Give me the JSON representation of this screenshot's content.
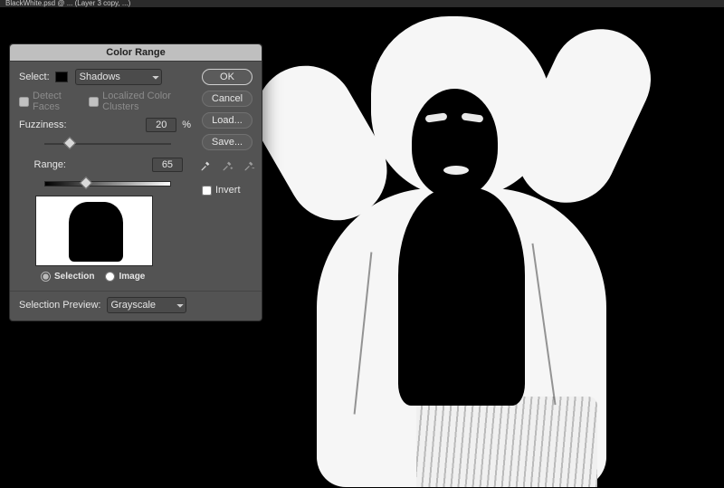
{
  "app": {
    "title_fragment": "BlackWhite.psd @ ... (Layer 3 copy, ...)"
  },
  "dialog": {
    "title": "Color Range",
    "select_label": "Select:",
    "select_value": "Shadows",
    "detect_faces_label": "Detect Faces",
    "detect_faces_checked": false,
    "localized_label": "Localized Color Clusters",
    "localized_checked": false,
    "fuzziness_label": "Fuzziness:",
    "fuzziness_value": "20",
    "fuzziness_unit": "%",
    "fuzziness_pos_pct": 20,
    "range_label": "Range:",
    "range_value": "65",
    "range_pos_pct": 33,
    "preview_mode": {
      "selection_label": "Selection",
      "image_label": "Image",
      "selected": "selection"
    },
    "selection_preview_label": "Selection Preview:",
    "selection_preview_value": "Grayscale",
    "buttons": {
      "ok": "OK",
      "cancel": "Cancel",
      "load": "Load...",
      "save": "Save..."
    },
    "eyedroppers": {
      "sample": "eyedropper",
      "add": "eyedropper-plus",
      "subtract": "eyedropper-minus"
    },
    "invert_label": "Invert",
    "invert_checked": false
  }
}
